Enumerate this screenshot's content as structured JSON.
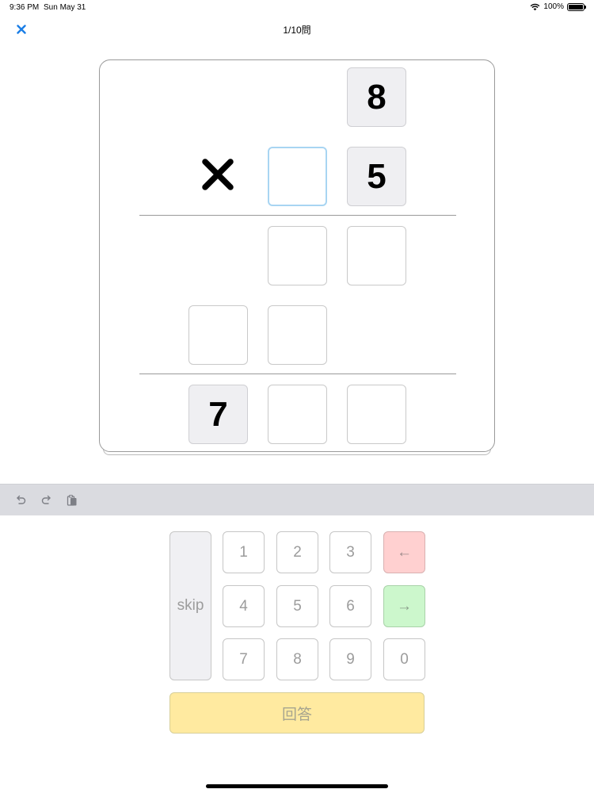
{
  "status": {
    "time": "9:36 PM",
    "date": "Sun May 31",
    "battery": "100%"
  },
  "nav": {
    "title": "1/10問",
    "close_icon": "close-icon"
  },
  "puzzle": {
    "multiplicand_digit": "8",
    "multiplier_digit": "5",
    "result_digit": "7",
    "operator_icon": "times-icon"
  },
  "toolbar": {
    "icons": [
      "undo-icon",
      "redo-icon",
      "paste-icon"
    ]
  },
  "keypad": {
    "skip": "skip",
    "digits": [
      "1",
      "2",
      "3",
      "4",
      "5",
      "6",
      "7",
      "8",
      "9",
      "0"
    ],
    "backspace": "←",
    "forward": "→",
    "answer": "回答"
  },
  "colors": {
    "accent": "#1a7ee6",
    "backspace_key": "#ffd0d0",
    "forward_key": "#ccf7cc",
    "answer_button": "#ffeaa0",
    "active_cell_border": "#a8d5f2",
    "toolbar": "#dadbe0"
  }
}
